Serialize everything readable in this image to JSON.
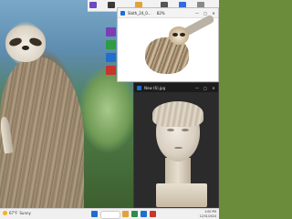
{
  "desktop": {
    "icons": [
      {
        "name": "desktop-icon-purple",
        "color": "#7b3fb5"
      },
      {
        "name": "desktop-icon-green",
        "color": "#2e9b45"
      },
      {
        "name": "desktop-icon-blue",
        "color": "#1f6fd1"
      },
      {
        "name": "desktop-icon-red",
        "color": "#c8352b"
      }
    ]
  },
  "windows": {
    "top": {
      "title": "Sloth_24_0...",
      "zoom": "82%",
      "controls": {
        "minimize": "—",
        "maximize": "□",
        "close": "✕"
      }
    },
    "bottom": {
      "title": "New (6).jpg",
      "controls": {
        "minimize": "—",
        "maximize": "□",
        "close": "✕"
      }
    }
  },
  "taskbar": {
    "weather_temp": "67°F",
    "weather_text": "Sunny",
    "time": "1:00 PM",
    "date": "12/31/2024"
  },
  "colors": {
    "accent": "#1f6fd1",
    "taskbar_bg": "#f0f0f0",
    "dark_window": "#202020"
  }
}
